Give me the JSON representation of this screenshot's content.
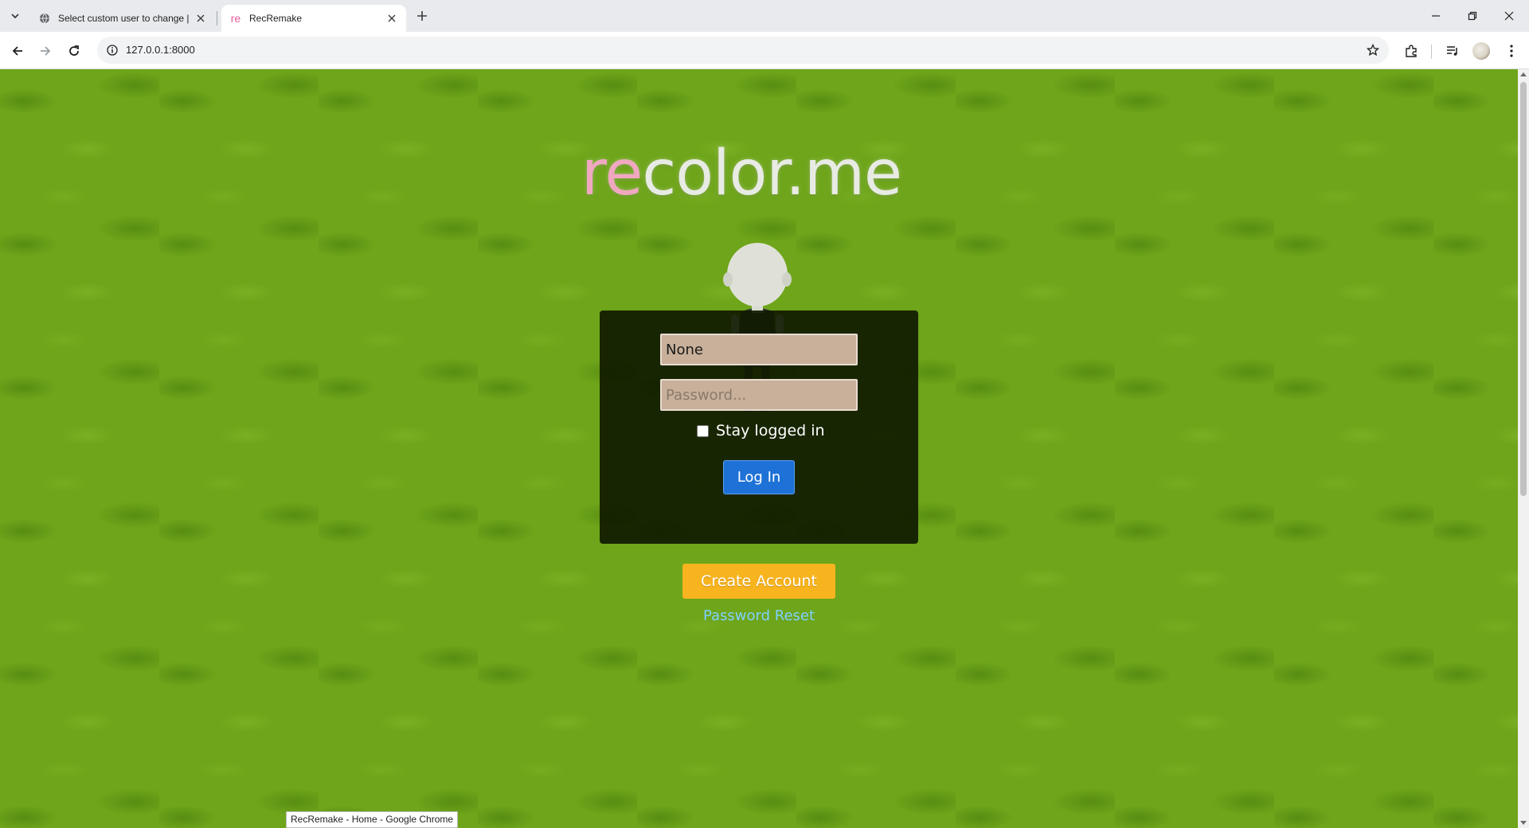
{
  "browser": {
    "tabs": [
      {
        "title": "Select custom user to change |",
        "active": false,
        "favicon": "globe-icon"
      },
      {
        "title": "RecRemake",
        "active": true,
        "favicon_text": "re"
      }
    ],
    "address": "127.0.0.1:8000",
    "status_tooltip": "RecRemake - Home - Google Chrome",
    "colors": {
      "tabstrip": "#e8eaed",
      "favicon_accent": "#e8609a"
    }
  },
  "page": {
    "logo_accent": "re",
    "logo_rest": "color.me",
    "login": {
      "username_value": "None",
      "password_placeholder": "Password...",
      "remember_label": "Stay logged in",
      "remember_checked": false,
      "submit_label": "Log In"
    },
    "create_account_label": "Create Account",
    "password_reset_label": "Password Reset",
    "colors": {
      "background": "#6ea51a",
      "logo_accent": "#f0a8c0",
      "panel": "#101a00",
      "field": "#c8b09a",
      "login_button": "#1e71d6",
      "create_button": "#f8b41e",
      "reset_link": "#7fd0ff"
    }
  }
}
